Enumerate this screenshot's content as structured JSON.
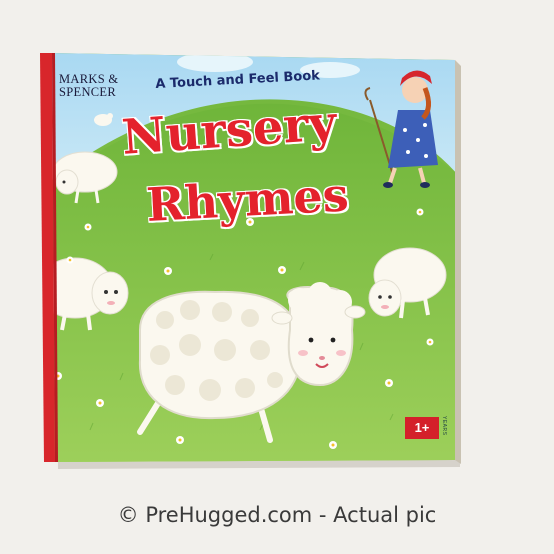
{
  "book": {
    "brand_line1": "MARKS &",
    "brand_line2": "SPENCER",
    "subtitle": "A Touch and Feel Book",
    "title_line1": "Nursery",
    "title_line2": "Rhymes",
    "age_label": "1+",
    "age_unit": "YEARS"
  },
  "watermark": "© PreHugged.com - Actual pic",
  "colors": {
    "background": "#f2f0ec",
    "sky": "#9dd3ef",
    "hill": "#74b83f",
    "title_red": "#e4222c",
    "spine_red": "#d8262b",
    "sheep": "#fbf8ef"
  }
}
